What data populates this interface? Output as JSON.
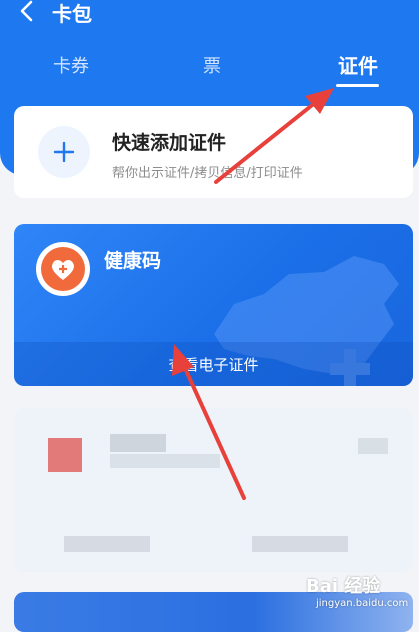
{
  "header": {
    "title": "卡包"
  },
  "tabs": [
    {
      "label": "卡券",
      "active": false
    },
    {
      "label": "票",
      "active": false
    },
    {
      "label": "证件",
      "active": true
    }
  ],
  "add_card": {
    "title": "快速添加证件",
    "subtitle": "帮你出示证件/拷贝信息/打印证件"
  },
  "health_card": {
    "title": "健康码",
    "view_label": "查看电子证件"
  },
  "watermark": {
    "main": "Bai 经验",
    "sub": "jingyan.baidu.com"
  },
  "colors": {
    "primary": "#1e78f0",
    "annotation_arrow": "#e8403a",
    "health_logo": "#f06a3b"
  }
}
